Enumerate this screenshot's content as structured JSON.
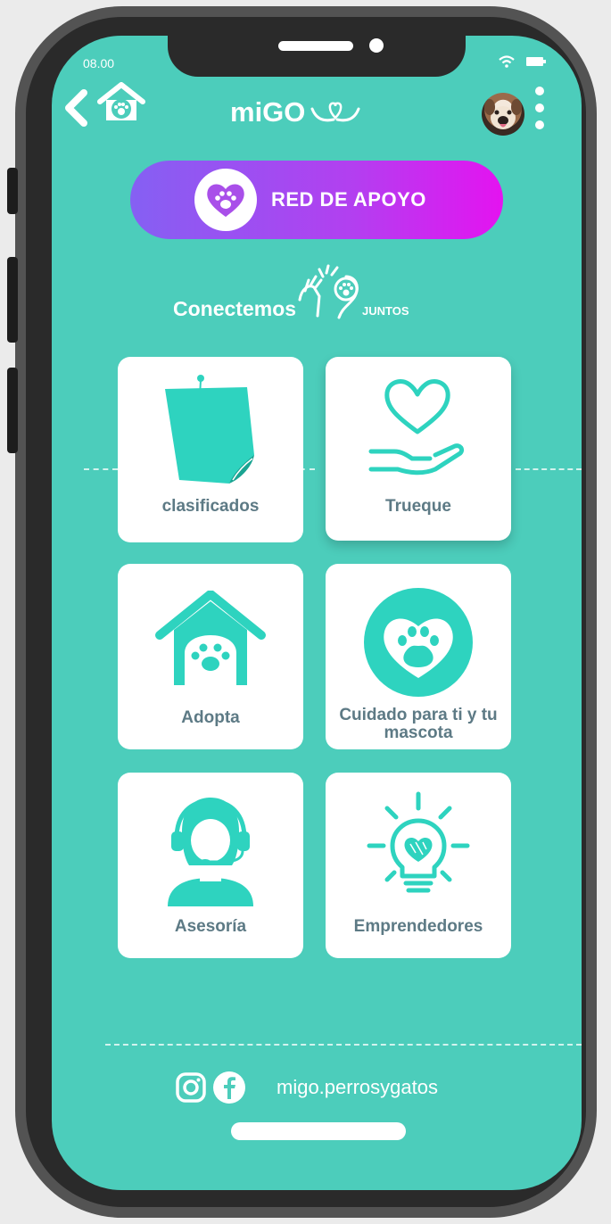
{
  "status_bar": {
    "time": "08.00"
  },
  "header": {
    "title": "miGO"
  },
  "banner": {
    "label": "RED DE APOYO"
  },
  "tagline": {
    "main": "Conectemos",
    "sub": "JUNTOS"
  },
  "cards": [
    {
      "label": "clasificados",
      "icon": "sticky-note-icon"
    },
    {
      "label": "Trueque",
      "icon": "hand-heart-icon"
    },
    {
      "label": "Adopta",
      "icon": "doghouse-paw-icon"
    },
    {
      "label": "Cuidado para ti y tu mascota",
      "icon": "heart-paw-icon"
    },
    {
      "label": "Asesoría",
      "icon": "headset-agent-icon"
    },
    {
      "label": "Emprendedores",
      "icon": "lightbulb-heart-icon"
    }
  ],
  "footer": {
    "handle": "migo.perrosygatos"
  },
  "colors": {
    "screen": "#4ccdbb",
    "accent": "#2ed3bf",
    "banner_start": "#8560f3",
    "banner_end": "#e413f0",
    "card_text": "#5d7a85"
  }
}
